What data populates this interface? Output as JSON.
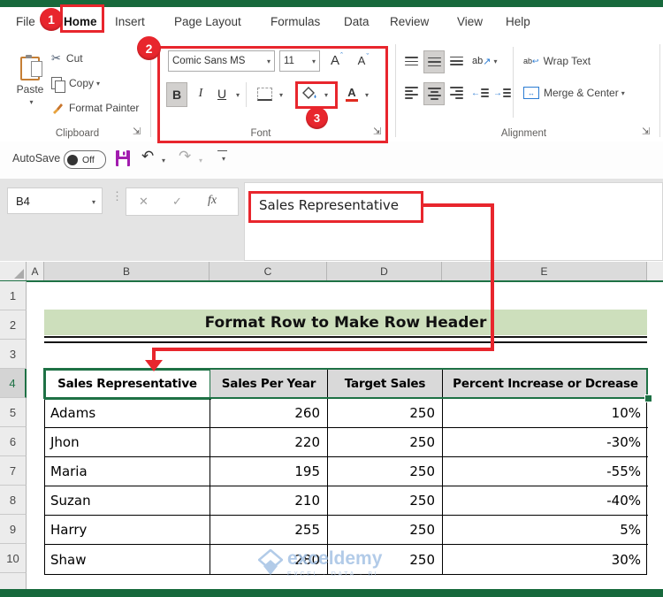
{
  "menu": {
    "items": [
      "File",
      "Home",
      "Insert",
      "Page Layout",
      "Formulas",
      "Data",
      "Review",
      "View",
      "Help"
    ],
    "active": "Home"
  },
  "ribbon": {
    "clipboard": {
      "title": "Clipboard",
      "paste_label": "Paste",
      "cut_label": "Cut",
      "copy_label": "Copy",
      "format_painter_label": "Format Painter"
    },
    "font": {
      "title": "Font",
      "font_name": "Comic Sans MS",
      "font_size": "11",
      "bold_label": "B",
      "italic_label": "I",
      "underline_label": "U",
      "grow_label": "A",
      "shrink_label": "A",
      "font_color_label": "A"
    },
    "alignment": {
      "title": "Alignment",
      "orientation_label": "ab",
      "wrap_label": "Wrap Text",
      "merge_label": "Merge & Center"
    }
  },
  "qat": {
    "autosave_label": "AutoSave",
    "autosave_state": "Off"
  },
  "formula": {
    "name_box": "B4",
    "cancel": "✕",
    "enter": "✓",
    "fx_label": "fx",
    "content": "Sales Representative"
  },
  "steps": {
    "one": "1",
    "two": "2",
    "three": "3"
  },
  "sheet": {
    "columns": [
      "A",
      "B",
      "C",
      "D",
      "E"
    ],
    "row_numbers": [
      "1",
      "2",
      "3",
      "4",
      "5",
      "6",
      "7",
      "8",
      "9",
      "10"
    ],
    "active_row": "4",
    "banner_title": "Format Row to Make Row Header",
    "table": {
      "headers": [
        "Sales Representative",
        "Sales Per Year",
        "Target Sales",
        "Percent Increase or Dcrease"
      ],
      "rows": [
        {
          "name": "Adams",
          "sales": "260",
          "target": "250",
          "percent": "10%"
        },
        {
          "name": "Jhon",
          "sales": "220",
          "target": "250",
          "percent": "-30%"
        },
        {
          "name": "Maria",
          "sales": "195",
          "target": "250",
          "percent": "-55%"
        },
        {
          "name": "Suzan",
          "sales": "210",
          "target": "250",
          "percent": "-40%"
        },
        {
          "name": "Harry",
          "sales": "255",
          "target": "250",
          "percent": "5%"
        },
        {
          "name": "Shaw",
          "sales": "280",
          "target": "250",
          "percent": "30%"
        }
      ]
    }
  },
  "watermark": {
    "name": "exceldemy",
    "tagline": "EXCEL · DATA · BI"
  },
  "colors": {
    "excel_green": "#17693C",
    "selection_green": "#1E7145",
    "annotation_red": "#E8262D",
    "banner_green": "#CDDFBC",
    "header_gray": "#D9D9D9",
    "save_purple": "#A21CAF"
  }
}
